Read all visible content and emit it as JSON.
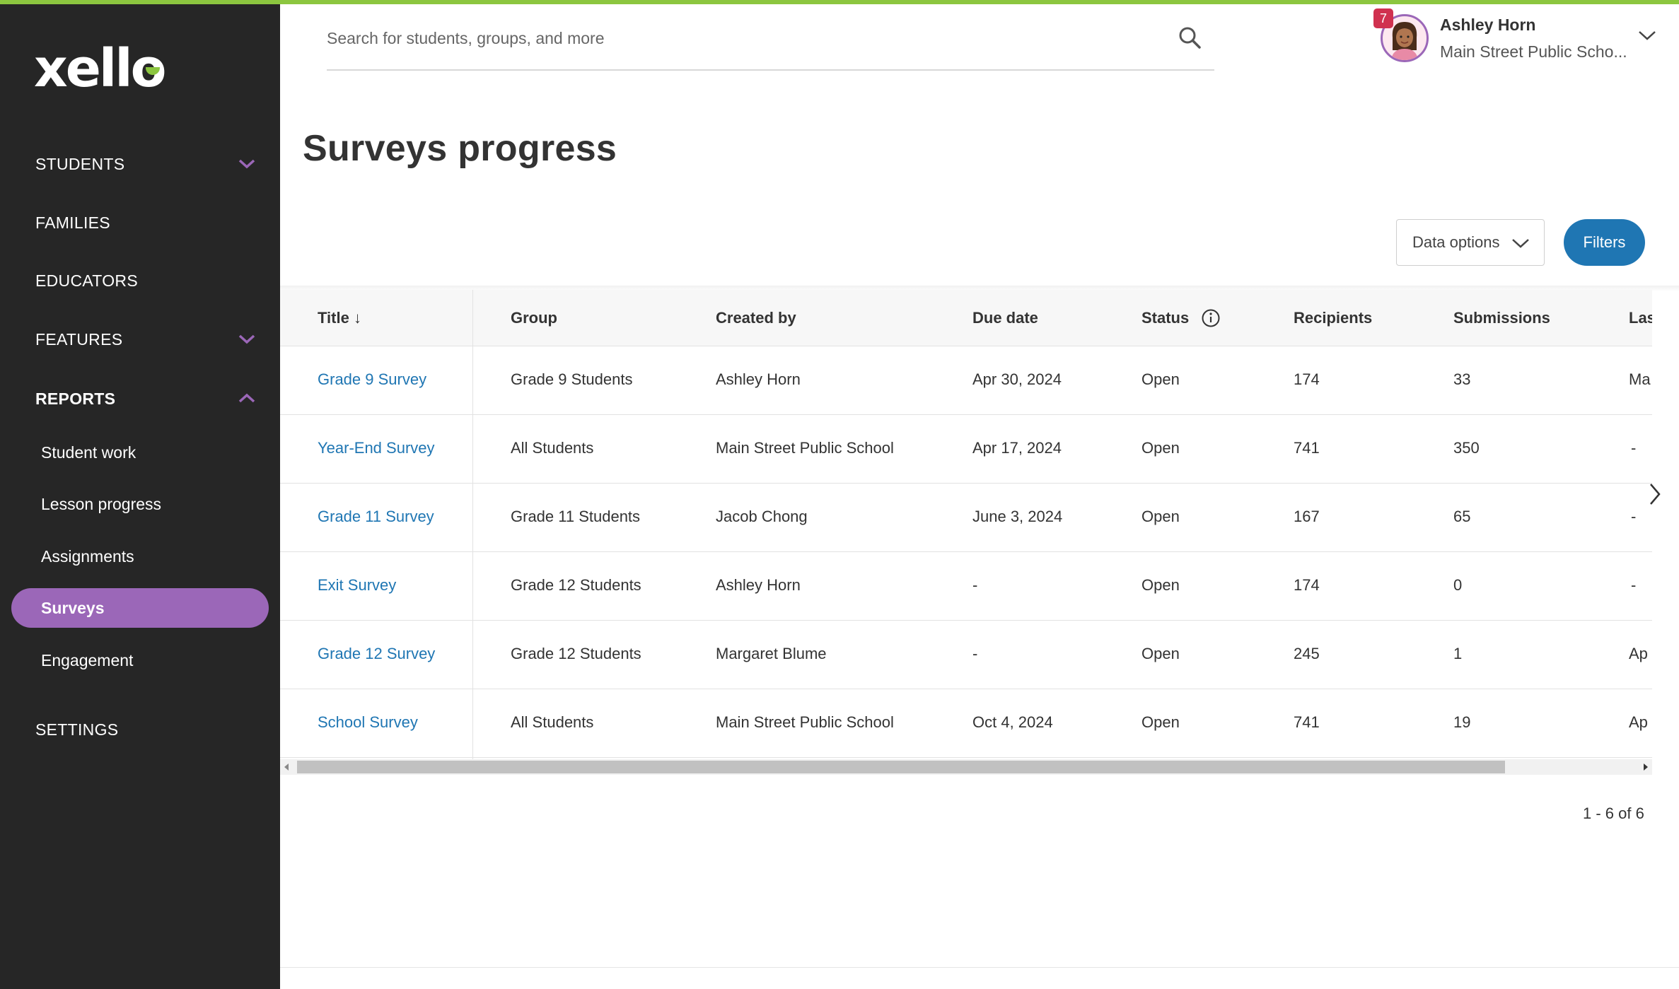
{
  "brand": {
    "logo_text": "xello",
    "accent": "#8cc63f",
    "sidebar_bg": "#262626",
    "active_bg": "#9b67b8",
    "link_color": "#1f76b3"
  },
  "sidebar": {
    "students": "STUDENTS",
    "families": "FAMILIES",
    "educators": "EDUCATORS",
    "features": "FEATURES",
    "reports": "REPORTS",
    "reports_items": [
      {
        "label": "Student work"
      },
      {
        "label": "Lesson progress"
      },
      {
        "label": "Assignments"
      },
      {
        "label": "Surveys",
        "active": true
      },
      {
        "label": "Engagement"
      }
    ],
    "settings": "SETTINGS"
  },
  "header": {
    "search_placeholder": "Search for students, groups, and more",
    "notifications_count": "7",
    "user_name": "Ashley Horn",
    "user_school": "Main Street Public Scho..."
  },
  "page": {
    "title": "Surveys progress",
    "data_options_label": "Data options",
    "filters_label": "Filters",
    "pagination": "1 - 6 of 6"
  },
  "table": {
    "columns": {
      "title": "Title ↓",
      "group": "Group",
      "created_by": "Created by",
      "due_date": "Due date",
      "status": "Status",
      "recipients": "Recipients",
      "submissions": "Submissions",
      "last": "Las"
    },
    "rows": [
      {
        "title": "Grade 9 Survey",
        "group": "Grade 9 Students",
        "created_by": "Ashley Horn",
        "due_date": "Apr 30, 2024",
        "status": "Open",
        "recipients": "174",
        "submissions": "33",
        "last": "Ma"
      },
      {
        "title": "Year-End Survey",
        "group": "All Students",
        "created_by": "Main Street Public School",
        "due_date": "Apr 17, 2024",
        "status": "Open",
        "recipients": "741",
        "submissions": "350",
        "last": "-"
      },
      {
        "title": "Grade 11 Survey",
        "group": "Grade 11 Students",
        "created_by": "Jacob Chong",
        "due_date": "June 3, 2024",
        "status": "Open",
        "recipients": "167",
        "submissions": "65",
        "last": "-"
      },
      {
        "title": "Exit Survey",
        "group": "Grade 12 Students",
        "created_by": "Ashley Horn",
        "due_date": "-",
        "status": "Open",
        "recipients": "174",
        "submissions": "0",
        "last": "-"
      },
      {
        "title": "Grade 12 Survey",
        "group": "Grade 12 Students",
        "created_by": "Margaret Blume",
        "due_date": "-",
        "status": "Open",
        "recipients": "245",
        "submissions": "1",
        "last": "Ap"
      },
      {
        "title": "School Survey",
        "group": "All Students",
        "created_by": "Main Street Public School",
        "due_date": "Oct 4, 2024",
        "status": "Open",
        "recipients": "741",
        "submissions": "19",
        "last": "Ap"
      }
    ]
  }
}
